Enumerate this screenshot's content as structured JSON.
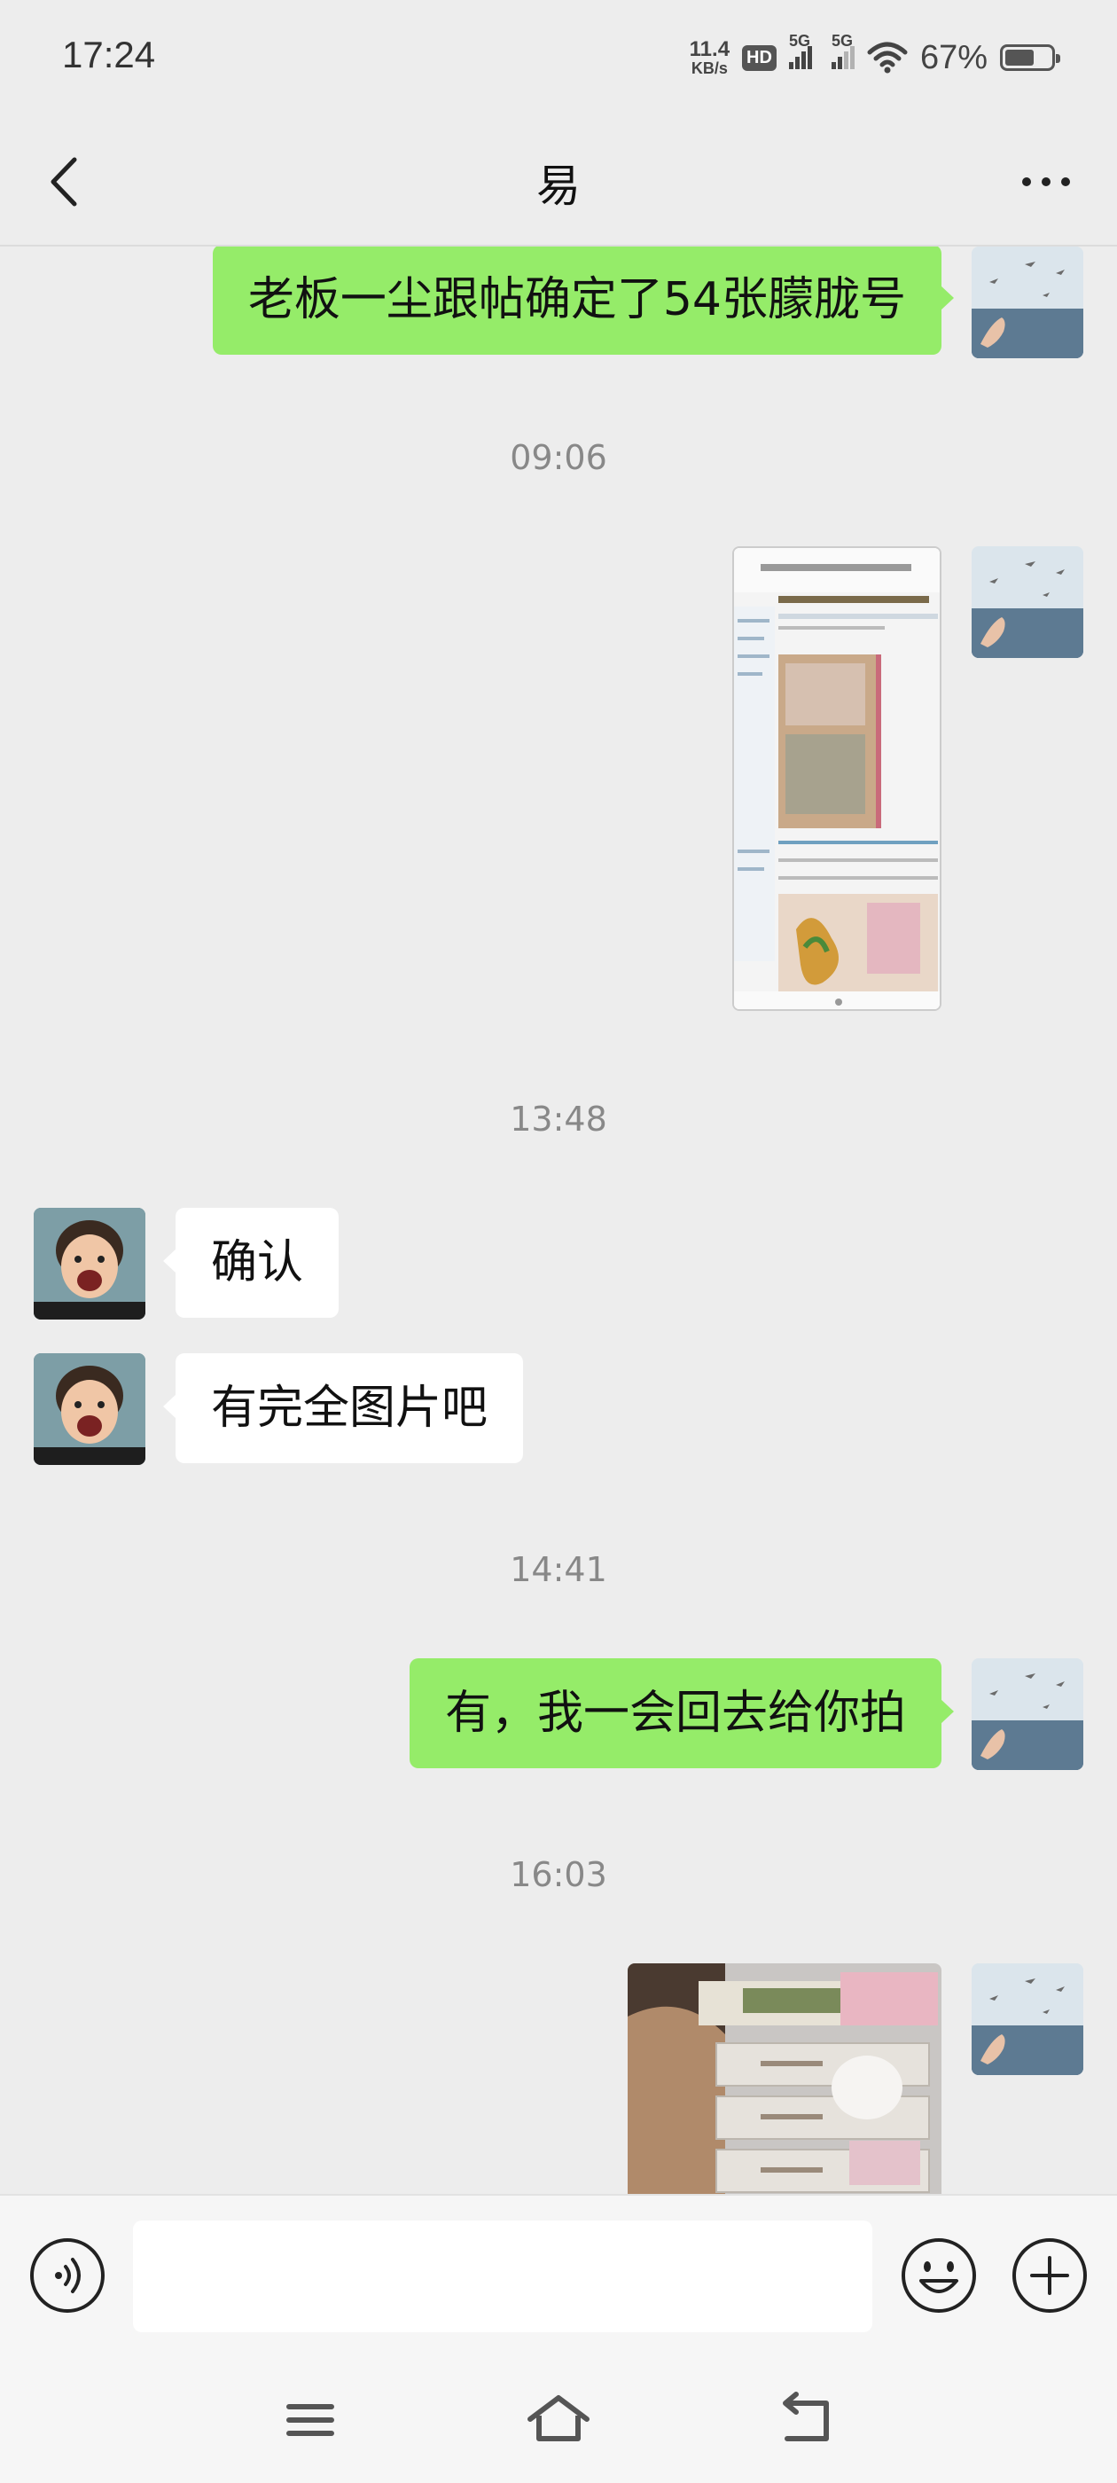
{
  "status_bar": {
    "time": "17:24",
    "net_speed_value": "11.4",
    "net_speed_unit": "KB/s",
    "hd_label": "HD",
    "signal_labels": [
      "5G",
      "5G"
    ],
    "battery_percent": "67%",
    "battery_level": 0.67
  },
  "header": {
    "title": "易",
    "back_icon": "chevron-left-icon",
    "more_icon": "ellipsis-icon"
  },
  "messages": [
    {
      "type": "text",
      "side": "out",
      "text": "老板一尘跟帖确定了54张朦胧号"
    },
    {
      "type": "timestamp",
      "text": "09:06"
    },
    {
      "type": "image",
      "side": "out",
      "description_icon": "screenshot-thumbnail"
    },
    {
      "type": "timestamp",
      "text": "13:48"
    },
    {
      "type": "text",
      "side": "in",
      "text": "确认"
    },
    {
      "type": "text",
      "side": "in",
      "text": "有完全图片吧"
    },
    {
      "type": "timestamp",
      "text": "14:41"
    },
    {
      "type": "text",
      "side": "out",
      "text": "有，我一会回去给你拍"
    },
    {
      "type": "timestamp",
      "text": "16:03"
    },
    {
      "type": "image",
      "side": "out",
      "description_icon": "photo-thumbnail"
    }
  ],
  "input_bar": {
    "placeholder": "",
    "voice_icon": "voice-input-icon",
    "emoji_icon": "emoji-icon",
    "plus_icon": "plus-icon"
  },
  "nav_bar": {
    "icons": [
      "menu-icon",
      "home-icon",
      "back-icon"
    ]
  },
  "colors": {
    "background": "#ededed",
    "out_bubble": "#95ec69",
    "in_bubble": "#ffffff",
    "timestamp": "#888888"
  }
}
